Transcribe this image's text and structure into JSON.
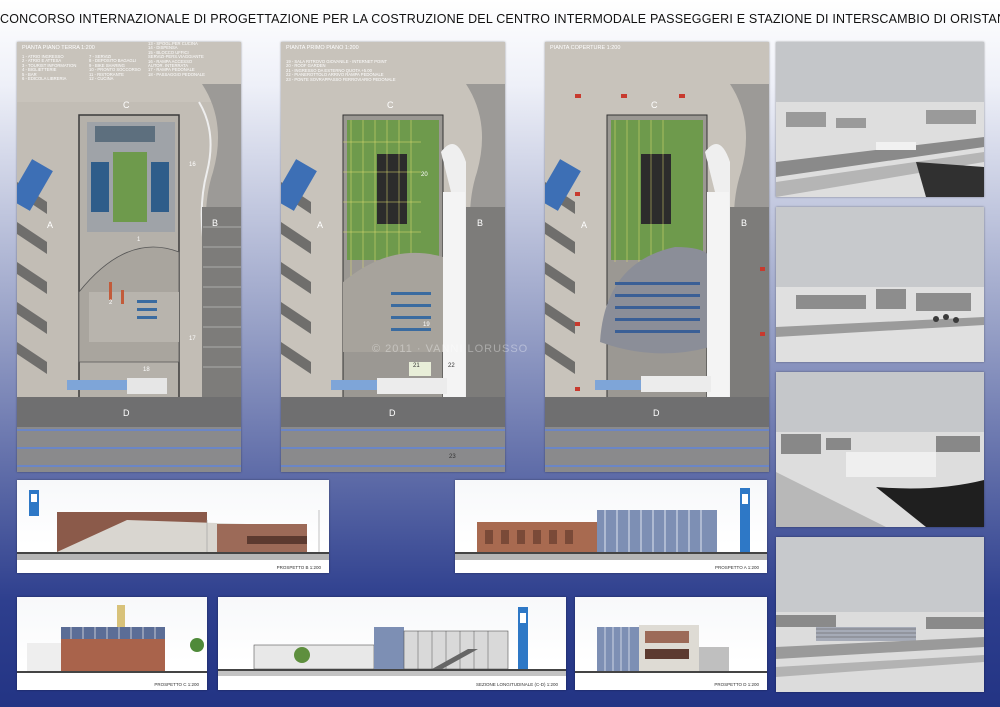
{
  "title": "CONCORSO INTERNAZIONALE DI PROGETTAZIONE PER LA COSTRUZIONE DEL CENTRO INTERMODALE PASSEGGERI E STAZIONE DI INTERSCAMBIO DI ORISTANO",
  "watermark": "© 2011 · VANNI LORUSSO",
  "plans": {
    "ground": {
      "title": "PIANTA PIANO TERRA 1:200",
      "legend_col1": [
        "1 - ATRIO INGRESSO",
        "2 - ATRIO E ATTESA",
        "3 - TOURIST INFORMATION",
        "4 - BIGLIETTERIE",
        "5 - BAR",
        "6 - EDICOLA LIBRERIA"
      ],
      "legend_col2": [
        "7 - SERVIZI",
        "8 - DEPOSITO BAGAGLI",
        "9 - BIKE SHARING",
        "10 - PRONTO SOCCORSO",
        "11 - RISTORANTE",
        "12 - CUCINA"
      ],
      "legend_col3": [
        "13 - SPOGL.PER CUCINA",
        "14 - DISPENSA",
        "15 - BLOCCO UFFICI",
        "SERVIZI-PERS.VIAGGIANTE",
        "16 - RAMPA ACCESSO",
        "AUTOR. INTERRATA",
        "17 - RAMPA PEDONALE",
        "18 - PASSAGGIO PEDONALE"
      ],
      "letters": {
        "a": "A",
        "b": "B",
        "c": "C",
        "d": "D"
      },
      "numbers": {
        "n1": "1",
        "n2": "2",
        "n16": "16",
        "n17": "17",
        "n18": "18"
      }
    },
    "first": {
      "title": "PIANTA PRIMO PIANO 1:200",
      "legend": [
        "19 - SALA RITROVO GIOVANILE - INTERNET POINT",
        "20 - ROOF GARDEN",
        "21 - INGRESSO DA ESTERNO QUOTA +5.00",
        "22 - PIANEROTTOLO ARRIVO RAMPA PEDONALE",
        "23 - PONTE SOVRAPPASSO FERROVIARIO PEDONALE"
      ],
      "letters": {
        "a": "A",
        "b": "B",
        "c": "C",
        "d": "D"
      },
      "numbers": {
        "n19": "19",
        "n20": "20",
        "n21": "21",
        "n22": "22",
        "n23": "23"
      }
    },
    "roof": {
      "title": "PIANTA COPERTURE 1:200",
      "letters": {
        "a": "A",
        "b": "B",
        "c": "C",
        "d": "D"
      }
    }
  },
  "elevations": {
    "b": "PROSPETTO B 1:200",
    "a": "PROSPETTO A 1:200",
    "c": "PROSPETTO C 1:200",
    "section": "SEZIONE LONGITUDINALE (C-D) 1:200",
    "d": "PROSPETTO D 1:200"
  }
}
